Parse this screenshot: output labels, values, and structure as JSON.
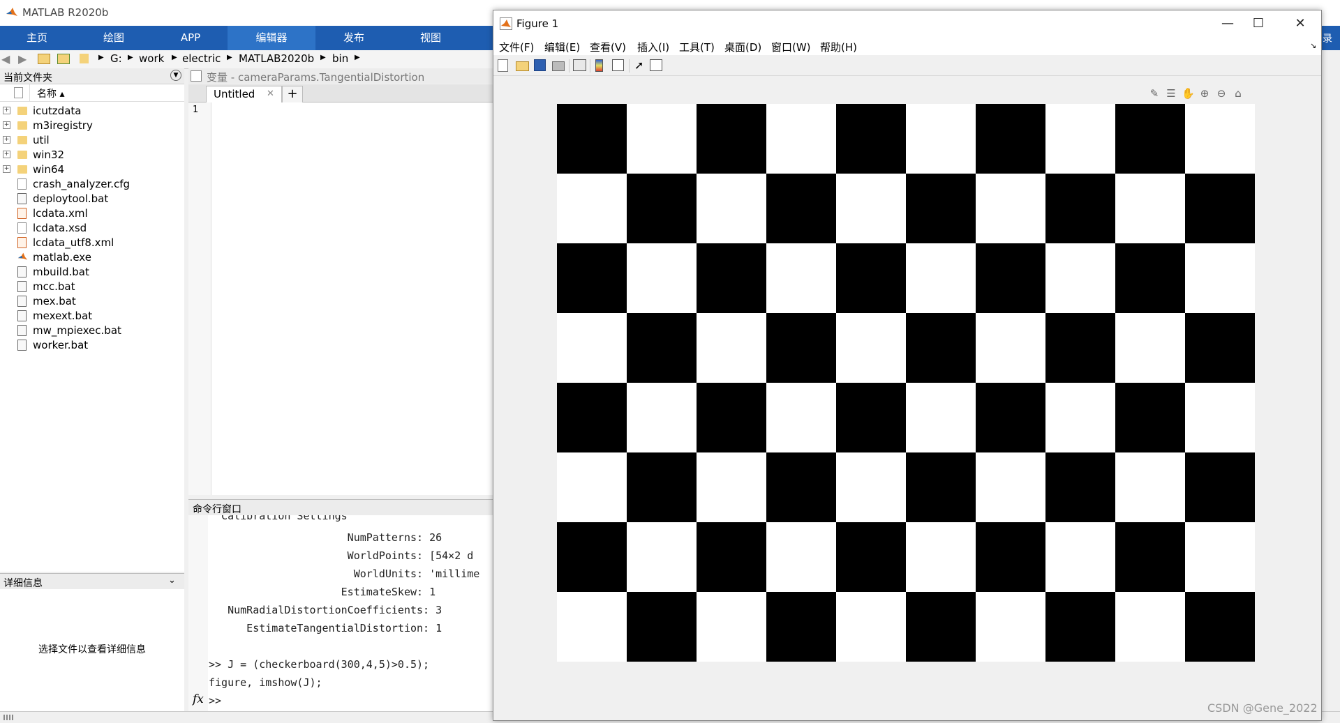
{
  "app": {
    "title": "MATLAB R2020b",
    "tabs": [
      {
        "label": "主页",
        "active": false
      },
      {
        "label": "绘图",
        "active": false
      },
      {
        "label": "APP",
        "active": false
      },
      {
        "label": "编辑器",
        "active": true
      },
      {
        "label": "发布",
        "active": false
      },
      {
        "label": "视图",
        "active": false
      }
    ],
    "right_tab_label": "录",
    "accent_color": "#1e5db1"
  },
  "address": {
    "crumbs": [
      "G:",
      "work",
      "electric",
      "MATLAB2020b",
      "bin"
    ]
  },
  "current_folder": {
    "title": "当前文件夹",
    "column_name": "名称 ▴",
    "items": [
      {
        "name": "icutzdata",
        "type": "folder",
        "expandable": true
      },
      {
        "name": "m3iregistry",
        "type": "folder",
        "expandable": true
      },
      {
        "name": "util",
        "type": "folder",
        "expandable": true
      },
      {
        "name": "win32",
        "type": "folder",
        "expandable": true
      },
      {
        "name": "win64",
        "type": "folder",
        "expandable": true
      },
      {
        "name": "crash_analyzer.cfg",
        "type": "file",
        "expandable": false
      },
      {
        "name": "deploytool.bat",
        "type": "bat",
        "expandable": false
      },
      {
        "name": "lcdata.xml",
        "type": "xml",
        "expandable": false
      },
      {
        "name": "lcdata.xsd",
        "type": "file",
        "expandable": false
      },
      {
        "name": "lcdata_utf8.xml",
        "type": "xml",
        "expandable": false
      },
      {
        "name": "matlab.exe",
        "type": "exe",
        "expandable": false
      },
      {
        "name": "mbuild.bat",
        "type": "bat",
        "expandable": false
      },
      {
        "name": "mcc.bat",
        "type": "bat",
        "expandable": false
      },
      {
        "name": "mex.bat",
        "type": "bat",
        "expandable": false
      },
      {
        "name": "mexext.bat",
        "type": "bat",
        "expandable": false
      },
      {
        "name": "mw_mpiexec.bat",
        "type": "bat",
        "expandable": false
      },
      {
        "name": "worker.bat",
        "type": "bat",
        "expandable": false
      }
    ]
  },
  "details": {
    "title": "详细信息",
    "message": "选择文件以查看详细信息"
  },
  "editor": {
    "title": "变量 - cameraParams.TangentialDistortion",
    "tab_label": "Untitled",
    "close_glyph": "✕",
    "add_glyph": "+",
    "line_number": "1"
  },
  "command_window": {
    "title": "命令行窗口",
    "lines": [
      "  Calibration Settings",
      "                      NumPatterns: 26",
      "                      WorldPoints: [54×2 d",
      "                       WorldUnits: 'millime",
      "                     EstimateSkew: 1",
      "   NumRadialDistortionCoefficients: 3",
      "      EstimateTangentialDistortion: 1",
      "",
      ">> J = (checkerboard(300,4,5)>0.5);",
      "figure, imshow(J);"
    ],
    "fx_symbol": "fx",
    "prompt": ">>"
  },
  "figure": {
    "title": "Figure 1",
    "menus": [
      "文件(F)",
      "编辑(E)",
      "查看(V)",
      "插入(I)",
      "工具(T)",
      "桌面(D)",
      "窗口(W)",
      "帮助(H)"
    ],
    "window_buttons": {
      "minimize": "—",
      "maximize": "☐",
      "close": "✕"
    },
    "checkerboard": {
      "rows": 8,
      "cols": 10,
      "top_left": "black",
      "colors": [
        "#000000",
        "#ffffff"
      ]
    }
  },
  "watermark": "CSDN @Gene_2022"
}
